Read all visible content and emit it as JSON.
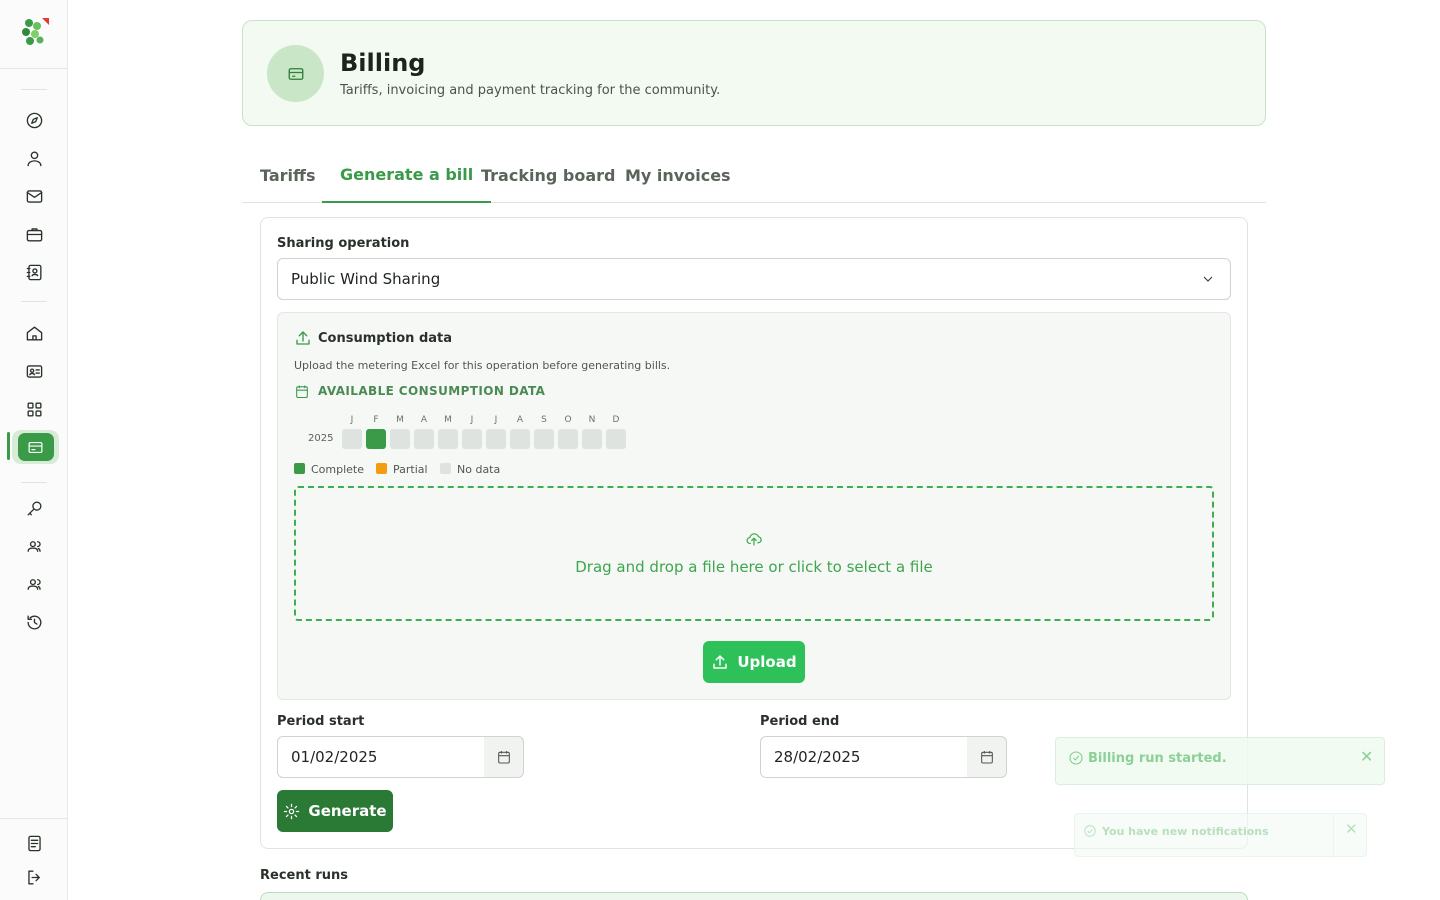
{
  "sidebar": {
    "items": [
      {
        "icon": "compass-icon"
      },
      {
        "icon": "user-icon"
      },
      {
        "icon": "mail-icon"
      },
      {
        "icon": "briefcase-icon"
      },
      {
        "icon": "contacts-icon"
      },
      {
        "icon": "home-icon"
      },
      {
        "icon": "id-card-icon"
      },
      {
        "icon": "grid-icon"
      },
      {
        "icon": "billing-card-icon",
        "active": true
      },
      {
        "icon": "key-icon"
      },
      {
        "icon": "users-icon"
      },
      {
        "icon": "team-icon"
      },
      {
        "icon": "history-icon"
      },
      {
        "icon": "document-icon"
      },
      {
        "icon": "logout-icon"
      }
    ]
  },
  "header": {
    "title": "Billing",
    "subtitle": "Tariffs, invoicing and payment tracking for the community."
  },
  "tabs": [
    {
      "label": "Tariffs"
    },
    {
      "label": "Generate a bill",
      "active": true
    },
    {
      "label": "Tracking board"
    },
    {
      "label": "My invoices"
    }
  ],
  "form": {
    "sharing_label": "Sharing operation",
    "sharing_value": "Public Wind Sharing",
    "consumption": {
      "title": "Consumption data",
      "description": "Upload the metering Excel for this operation before generating bills.",
      "available_label": "AVAILABLE CONSUMPTION DATA",
      "year": "2025",
      "months": [
        "J",
        "F",
        "M",
        "A",
        "M",
        "J",
        "J",
        "A",
        "S",
        "O",
        "N",
        "D"
      ],
      "status": [
        "none",
        "complete",
        "none",
        "none",
        "none",
        "none",
        "none",
        "none",
        "none",
        "none",
        "none",
        "none"
      ],
      "legend": {
        "complete": "Complete",
        "partial": "Partial",
        "none": "No data"
      },
      "colors": {
        "complete": "#3a9a48",
        "partial": "#f39c12",
        "none": "#dfe3df"
      },
      "dropzone_text": "Drag and drop a file here or click to select a file",
      "upload_label": "Upload"
    },
    "period_start_label": "Period start",
    "period_start_value": "01/02/2025",
    "period_end_label": "Period end",
    "period_end_value": "28/02/2025",
    "generate_label": "Generate"
  },
  "recent_runs_label": "Recent runs",
  "toasts": [
    {
      "message": "Billing run started."
    },
    {
      "message": "You have new notifications"
    }
  ],
  "colors": {
    "accent": "#3a9a48",
    "upload": "#2ec15a",
    "generate": "#2a7a36"
  }
}
